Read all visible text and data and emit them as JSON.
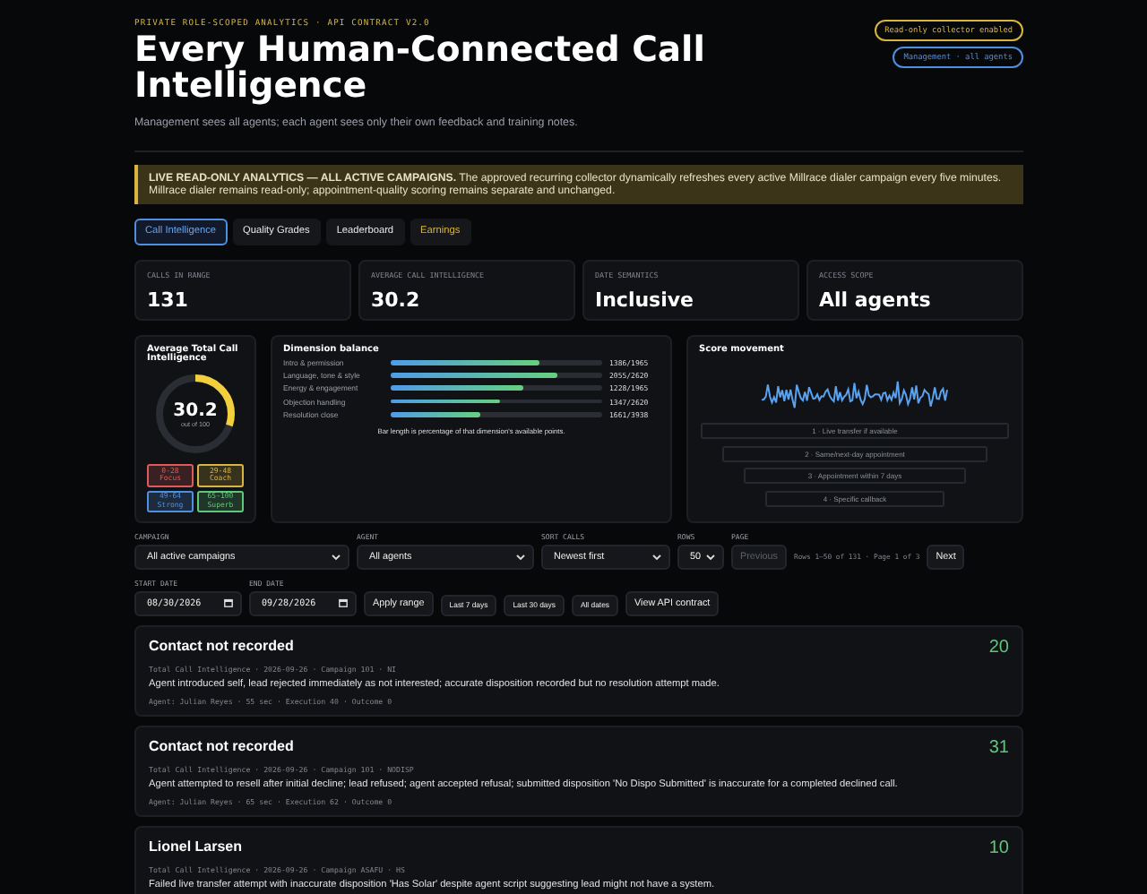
{
  "header": {
    "eyebrow": "PRIVATE ROLE-SCOPED ANALYTICS · API CONTRACT V2.0",
    "title": "Every Human-Connected Call Intelligence",
    "subtitle": "Management sees all agents; each agent sees only their own feedback and training notes.",
    "badges": [
      {
        "label": "Read-only collector enabled",
        "color": "#d9b440"
      },
      {
        "label": "Management · all agents",
        "color": "#4f8fe0"
      }
    ]
  },
  "banner": "**LIVE READ-ONLY ANALYTICS — ALL ACTIVE CAMPAIGNS.** The approved recurring collector dynamically refreshes every active Millrace dialer campaign every five minutes. Millrace dialer remains read-only; appointment-quality scoring remains separate and unchanged.",
  "tabs": [
    {
      "label": "Call Intelligence",
      "selected": true,
      "highlight": false
    },
    {
      "label": "Quality Grades",
      "selected": false,
      "highlight": false
    },
    {
      "label": "Leaderboard",
      "selected": false,
      "highlight": false
    },
    {
      "label": "Earnings",
      "selected": false,
      "highlight": true
    }
  ],
  "stats": [
    {
      "label": "CALLS IN RANGE",
      "value": "131"
    },
    {
      "label": "AVERAGE CALL INTELLIGENCE",
      "value": "30.2"
    },
    {
      "label": "DATE SEMANTICS",
      "value": "Inclusive"
    },
    {
      "label": "ACCESS SCOPE",
      "value": "All agents"
    }
  ],
  "gauge": {
    "title": "Average Total Call Intelligence",
    "value": "30.2",
    "caption": "out of 100",
    "level": 0.302,
    "bands": [
      {
        "range": "0-28",
        "label": "Focus",
        "color": "#e05a5a"
      },
      {
        "range": "29-48",
        "label": "Coach",
        "color": "#d9b440"
      },
      {
        "range": "49-64",
        "label": "Strong",
        "color": "#4f8fe0"
      },
      {
        "range": "65-100",
        "label": "Superb",
        "color": "#5fc77a"
      }
    ]
  },
  "dimensions": {
    "title": "Dimension balance",
    "items": [
      {
        "label": "Intro & permission",
        "reading": "1386/1965",
        "level": 0.705
      },
      {
        "label": "Language, tone & style",
        "reading": "2055/2620",
        "level": 0.784
      },
      {
        "label": "Energy & engagement",
        "reading": "1228/1965",
        "level": 0.625
      },
      {
        "label": "Objection handling",
        "reading": "1347/2620",
        "level": 0.514
      },
      {
        "label": "Resolution close",
        "reading": "1661/3938",
        "level": 0.422
      }
    ],
    "note": "Bar length is percentage of that dimension's available points."
  },
  "movement": {
    "title": "Score movement",
    "steps": [
      "1 · Live transfer if available",
      "2 · Same/next-day appointment",
      "3 · Appointment within 7 days",
      "4 · Specific callback"
    ]
  },
  "filters": {
    "campaign": {
      "label": "CAMPAIGN",
      "value": "All active campaigns"
    },
    "agent": {
      "label": "AGENT",
      "value": "All agents"
    },
    "sort": {
      "label": "SORT CALLS",
      "value": "Newest first"
    },
    "rows": {
      "label": "ROWS",
      "value": "50"
    },
    "page_label": "PAGE",
    "previous": {
      "label": "Previous",
      "disabled": true
    },
    "page_info": "Rows 1–50 of 131 · Page 1 of 3",
    "next": {
      "label": "Next",
      "disabled": false
    },
    "start": {
      "label": "START DATE",
      "value": "08/30/2026"
    },
    "end": {
      "label": "END DATE",
      "value": "09/28/2026"
    },
    "buttons": [
      "Apply range",
      "Last 7 days",
      "Last 30 days",
      "All dates",
      "View API contract"
    ]
  },
  "calls": [
    {
      "title": "Contact not recorded",
      "score": "20",
      "meta": "Total Call Intelligence · 2026-09-26 · Campaign 101 · NI",
      "description": "Agent introduced self, lead rejected immediately as not interested; accurate disposition recorded but no resolution attempt made.",
      "footer": "Agent: Julian Reyes · 55 sec · Execution 40 · Outcome 0"
    },
    {
      "title": "Contact not recorded",
      "score": "31",
      "meta": "Total Call Intelligence · 2026-09-26 · Campaign 101 · NODISP",
      "description": "Agent attempted to resell after initial decline; lead refused; agent accepted refusal; submitted disposition 'No Dispo Submitted' is inaccurate for a completed declined call.",
      "footer": "Agent: Julian Reyes · 65 sec · Execution 62 · Outcome 0"
    },
    {
      "title": "Lionel Larsen",
      "score": "10",
      "meta": "Total Call Intelligence · 2026-09-26 · Campaign ASAFU · HS",
      "description": "Failed live transfer attempt with inaccurate disposition 'Has Solar' despite agent script suggesting lead might not have a system."
    }
  ]
}
